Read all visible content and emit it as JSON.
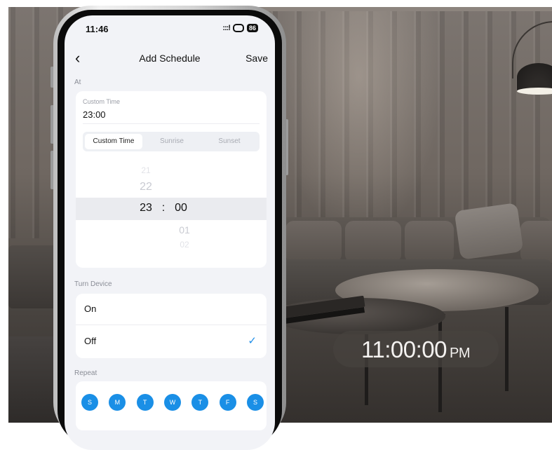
{
  "status_bar": {
    "time": "11:46",
    "signal": ":::!",
    "battery": "86"
  },
  "nav": {
    "back_glyph": "‹",
    "title": "Add Schedule",
    "save_label": "Save"
  },
  "at_section": {
    "label": "At",
    "custom_time_label": "Custom Time",
    "custom_time_value": "23:00",
    "segments": [
      "Custom Time",
      "Sunrise",
      "Sunset"
    ],
    "selected_segment": "Custom Time",
    "picker": {
      "hours_above": [
        "21",
        "22"
      ],
      "hour_selected": "23",
      "separator": ":",
      "minute_selected": "00",
      "minutes_below": [
        "01",
        "02"
      ]
    }
  },
  "turn_device": {
    "label": "Turn Device",
    "options": [
      "On",
      "Off"
    ],
    "selected": "Off",
    "check_glyph": "✓"
  },
  "repeat": {
    "label": "Repeat",
    "days": [
      "S",
      "M",
      "T",
      "W",
      "T",
      "F",
      "S"
    ]
  },
  "overlay_clock": {
    "time": "11:00:00",
    "period": "PM"
  },
  "colors": {
    "accent": "#1a8fe6",
    "screen_bg": "#f2f3f7",
    "card_bg": "#ffffff"
  }
}
